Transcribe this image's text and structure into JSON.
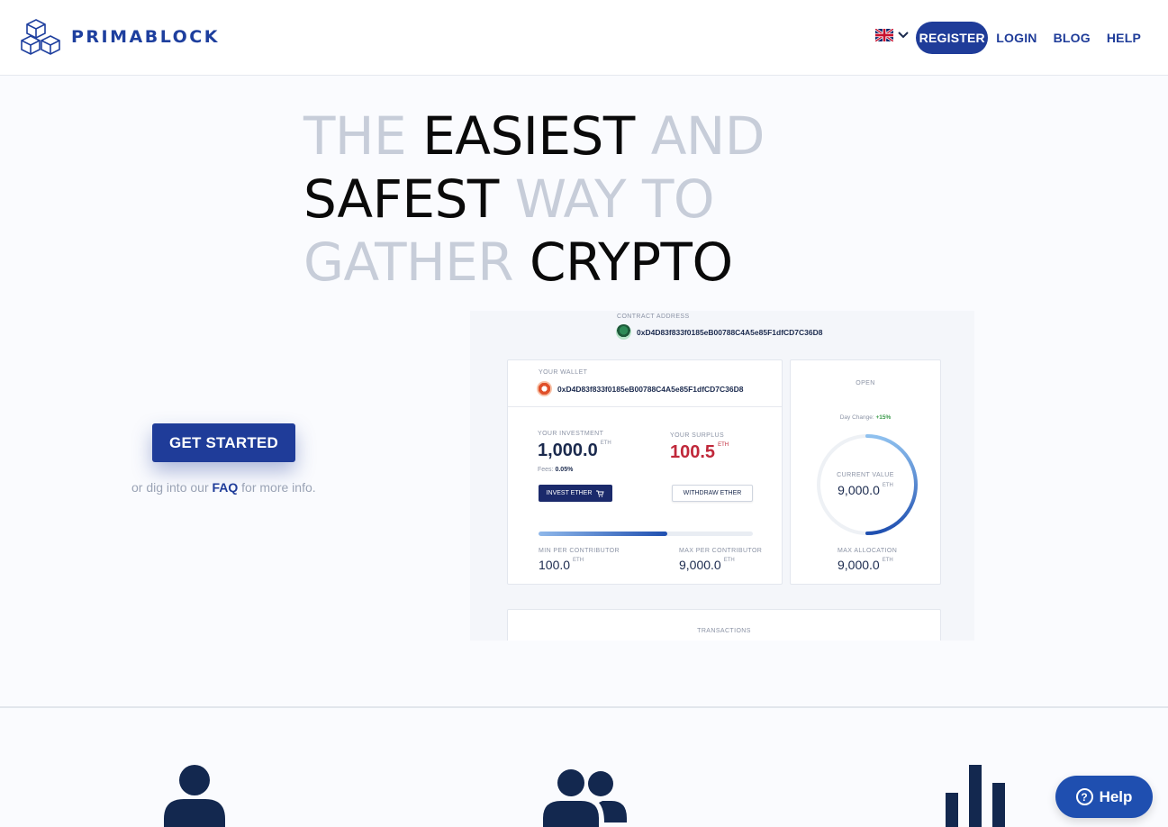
{
  "header": {
    "brand": "PRIMABLOCK",
    "nav": {
      "register": "REGISTER",
      "login": "LOGIN",
      "blog": "BLOG",
      "help": "HELP"
    }
  },
  "hero": {
    "headline": {
      "w1": "THE ",
      "w2": "EASIEST",
      "w3": " AND",
      "w4": "SAFEST",
      "w5": " WAY TO",
      "w6": "GATHER",
      "w7": " CRYPTO"
    },
    "cta": "GET STARTED",
    "faq_prefix": "or dig into our ",
    "faq_link": "FAQ",
    "faq_suffix": " for more info."
  },
  "preview": {
    "contract_label": "CONTRACT ADDRESS",
    "contract_address": "0xD4D83f833f0185eB00788C4A5e85F1dfCD7C36D8",
    "wallet_label": "YOUR WALLET",
    "wallet_address": "0xD4D83f833f0185eB00788C4A5e85F1dfCD7C36D8",
    "investment_label": "YOUR INVESTMENT",
    "investment_value": "1,000.0",
    "fees_label": "Fees:",
    "fees_value": "0.05%",
    "surplus_label": "YOUR SURPLUS",
    "surplus_value": "100.5",
    "unit": "ETH",
    "invest_button": "INVEST ETHER",
    "withdraw_button": "WITHDRAW ETHER",
    "progress_fraction": 0.6,
    "min_label": "MIN PER CONTRIBUTOR",
    "min_value": "100.0",
    "max_label": "MAX PER CONTRIBUTOR",
    "max_value": "9,000.0",
    "status": "OPEN",
    "day_change_label": "Day Change:",
    "day_change_value": "+15%",
    "current_value_label": "CURRENT VALUE",
    "current_value": "9,000.0",
    "max_allocation_label": "MAX ALLOCATION",
    "max_allocation_value": "9,000.0",
    "transactions_label": "TRANSACTIONS"
  },
  "help_widget": {
    "label": "Help"
  },
  "colors": {
    "brand": "#1f3c99",
    "accent": "#1f4fb0",
    "muted_headline": "#c7cdd9",
    "surplus": "#c0283a",
    "positive": "#3a9a4a"
  },
  "icons": [
    "logo-cubes-icon",
    "uk-flag-icon",
    "chevron-down-icon",
    "cart-icon",
    "user-icon",
    "users-icon",
    "bar-chart-icon",
    "question-icon"
  ]
}
